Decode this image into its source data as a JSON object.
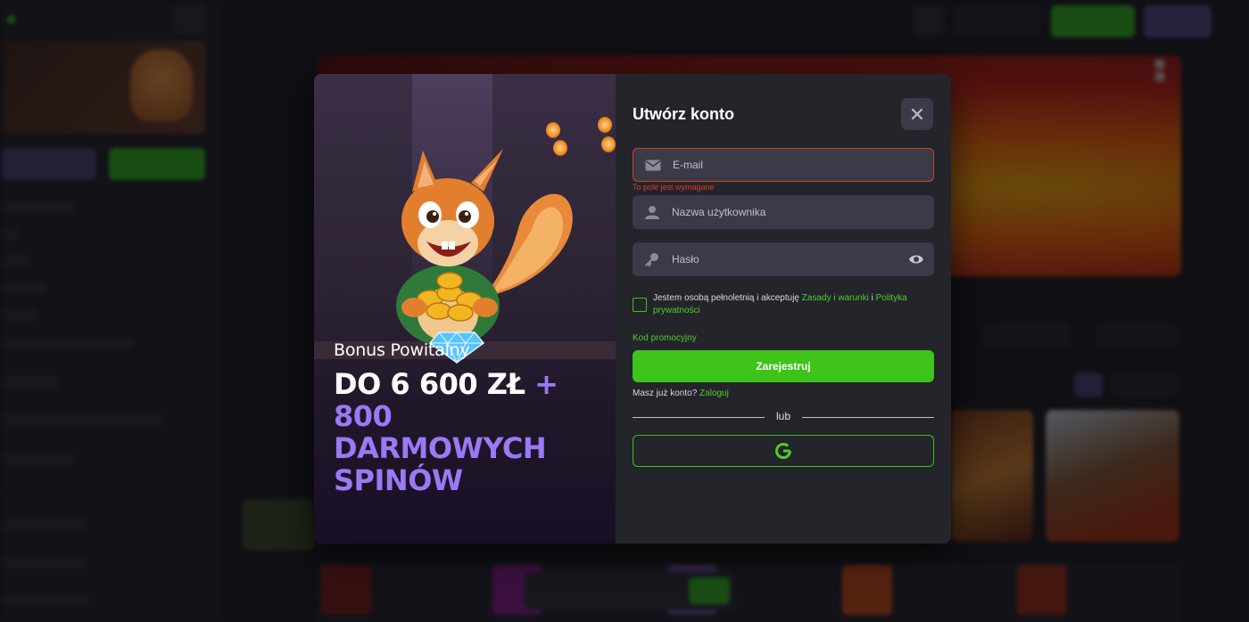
{
  "modal": {
    "title": "Utwórz konto",
    "bonus_subtitle": "Bonus Powitalny",
    "bonus_amount": "DO 6 600 ZŁ",
    "bonus_plus": "+",
    "bonus_spins_line1": "800",
    "bonus_spins_line2": "DARMOWYCH",
    "bonus_spins_line3": "SPINÓW",
    "email_placeholder": "E-mail",
    "email_error": "To pole jest wymagane",
    "username_placeholder": "Nazwa użytkownika",
    "password_placeholder": "Hasło",
    "consent_text": "Jestem osobą pełnoletnią i akceptuję",
    "consent_terms_link": "Zasady i warunki",
    "consent_and": "i",
    "consent_privacy_link": "Polityka prywatności",
    "promo_code_link": "Kod promocyjny",
    "register_label": "Zarejestruj",
    "have_account_text": "Masz już konto?",
    "login_link": "Zaloguj",
    "divider_label": "lub",
    "google_icon": "google-icon"
  },
  "colors": {
    "accent_green": "#3ec31b",
    "accent_purple": "#9b79f5",
    "error_red": "#d2401f",
    "modal_bg": "#24242b",
    "field_bg": "#3a3a48"
  }
}
